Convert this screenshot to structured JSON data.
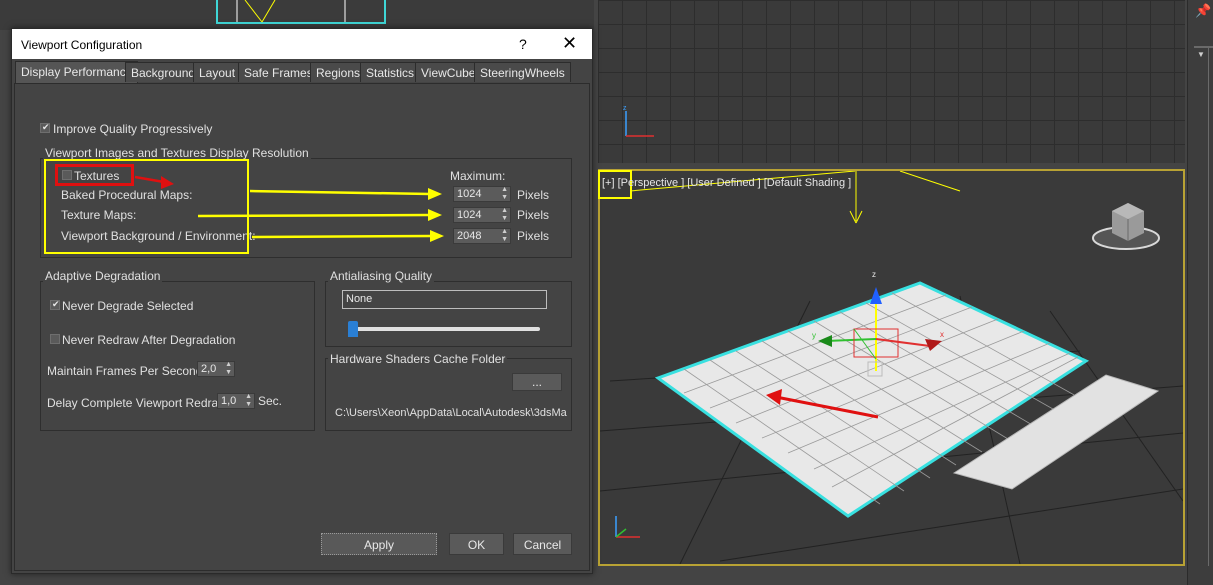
{
  "dialog": {
    "title": "Viewport Configuration",
    "help": "?",
    "close": "✕",
    "tabs": [
      "Display Performance",
      "Background",
      "Layout",
      "Safe Frames",
      "Regions",
      "Statistics",
      "ViewCube",
      "SteeringWheels"
    ],
    "improve_quality": "Improve Quality Progressively",
    "resolution_group": {
      "title": "Viewport Images and Textures Display Resolution",
      "textures": "Textures",
      "maximum": "Maximum:",
      "rows": [
        {
          "label": "Baked Procedural Maps:",
          "value": "1024",
          "unit": "Pixels"
        },
        {
          "label": "Texture Maps:",
          "value": "1024",
          "unit": "Pixels"
        },
        {
          "label": "Viewport Background / Environment:",
          "value": "2048",
          "unit": "Pixels"
        }
      ]
    },
    "adaptive": {
      "title": "Adaptive Degradation",
      "never_degrade": "Never Degrade Selected",
      "never_redraw": "Never Redraw After Degradation",
      "fps_label": "Maintain Frames Per Second:",
      "fps_value": "2,0",
      "delay_label": "Delay Complete Viewport Redraw:",
      "delay_value": "1,0",
      "delay_unit": "Sec."
    },
    "antialiasing": {
      "title": "Antialiasing Quality",
      "value": "None",
      "level": 0
    },
    "shaders": {
      "title": "Hardware Shaders Cache Folder",
      "browse": "...",
      "path": "C:\\Users\\Xeon\\AppData\\Local\\Autodesk\\3dsMa"
    },
    "buttons": {
      "apply": "Apply",
      "ok": "OK",
      "cancel": "Cancel"
    }
  },
  "viewport": {
    "plus": "[+]",
    "label": "[Perspective ] [User Defined ] [Default Shading ]"
  },
  "colors": {
    "highlight_yellow": "#ffff00",
    "highlight_red": "#e01010",
    "active_viewport": "#b8a234"
  }
}
